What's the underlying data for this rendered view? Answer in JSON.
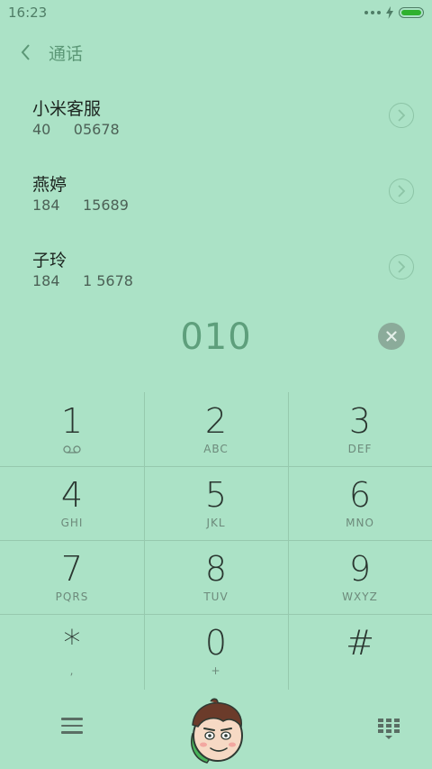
{
  "status_bar": {
    "time": "16:23"
  },
  "header": {
    "title": "通话"
  },
  "contacts": [
    {
      "name": "小米客服",
      "number": "40     05678"
    },
    {
      "name": "燕婷",
      "number": "184     15689"
    },
    {
      "name": "子玲",
      "number": "184     1 5678"
    }
  ],
  "dialer": {
    "entered_number": "010"
  },
  "keypad": [
    {
      "digit": "1",
      "letters": ""
    },
    {
      "digit": "2",
      "letters": "ABC"
    },
    {
      "digit": "3",
      "letters": "DEF"
    },
    {
      "digit": "4",
      "letters": "GHI"
    },
    {
      "digit": "5",
      "letters": "JKL"
    },
    {
      "digit": "6",
      "letters": "MNO"
    },
    {
      "digit": "7",
      "letters": "PQRS"
    },
    {
      "digit": "8",
      "letters": "TUV"
    },
    {
      "digit": "9",
      "letters": "WXYZ"
    },
    {
      "digit": "*",
      "letters": ","
    },
    {
      "digit": "0",
      "letters": "+"
    },
    {
      "digit": "#",
      "letters": ""
    }
  ],
  "icons": {
    "back": "chevron-left-icon",
    "voicemail": "voicemail-icon",
    "delete": "clear-icon",
    "menu": "menu-icon",
    "call": "call-avatar-icon",
    "keypad_toggle": "dialpad-hide-icon"
  },
  "colors": {
    "background": "#abe2c6",
    "accent": "#5e9f7c",
    "battery": "#2fb12f"
  }
}
